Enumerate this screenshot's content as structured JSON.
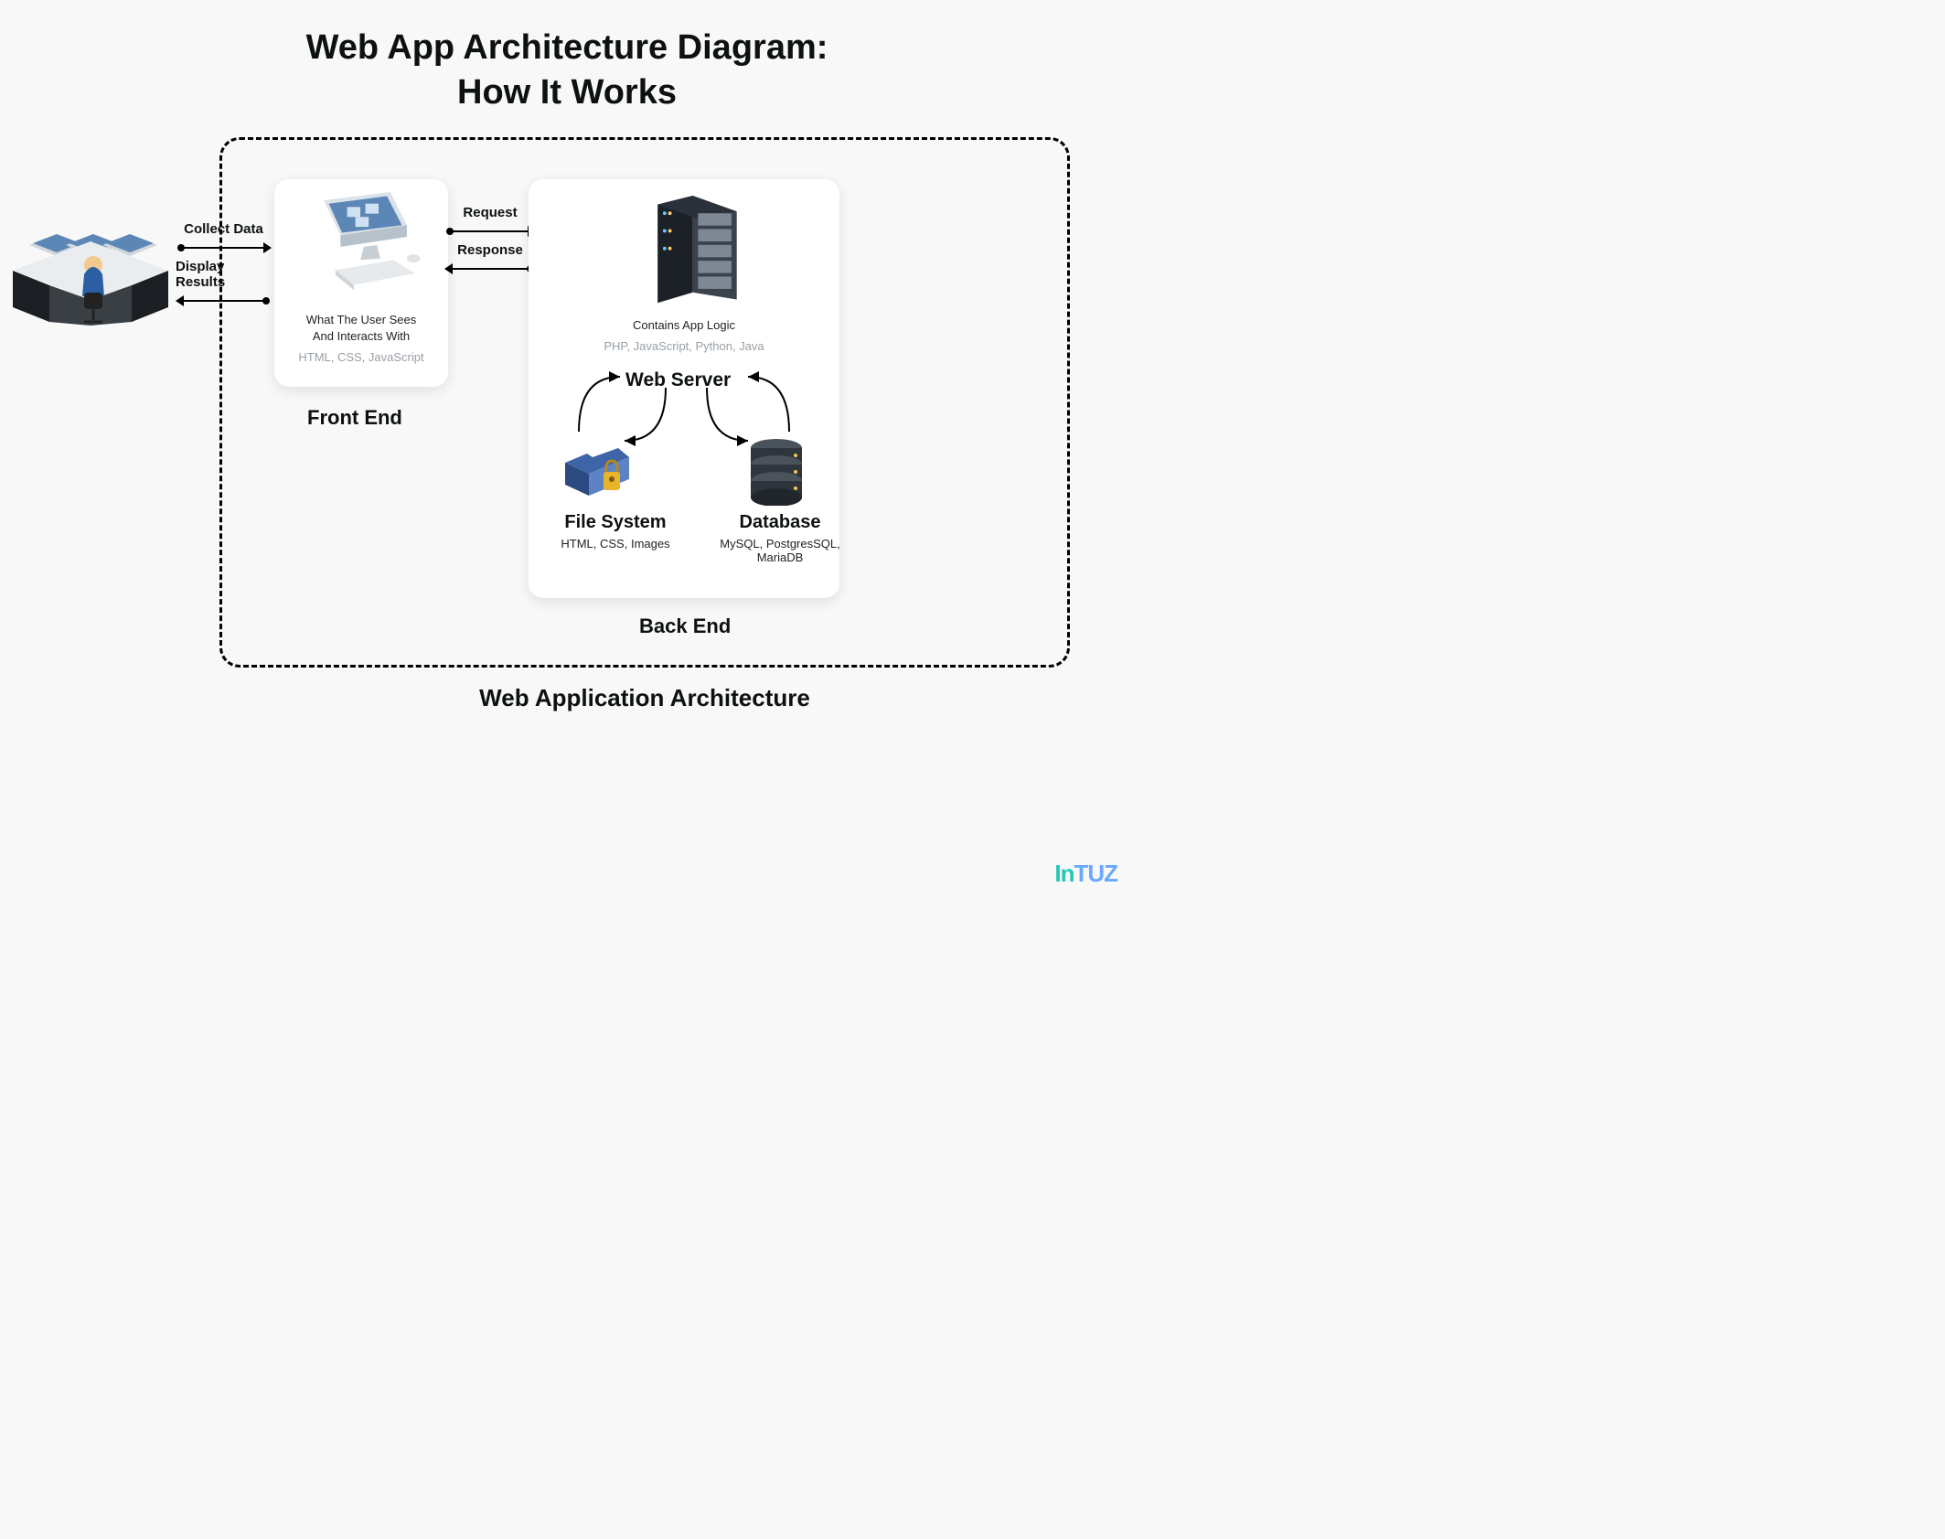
{
  "title_line1": "Web App Architecture Diagram:",
  "title_line2": "How It Works",
  "container_label": "Web Application Architecture",
  "actor_to_frontend": {
    "top_label": "Collect Data",
    "bottom_label": "Display Results"
  },
  "frontend_to_backend": {
    "top_label": "Request",
    "bottom_label": "Response"
  },
  "frontend": {
    "title": "Front End",
    "desc_line1": "What The User Sees",
    "desc_line2": "And Interacts With",
    "tech": "HTML, CSS, JavaScript"
  },
  "backend": {
    "title": "Back End",
    "server_desc": "Contains App Logic",
    "server_tech": "PHP, JavaScript, Python, Java",
    "webserver_label": "Web Server",
    "filesystem": {
      "title": "File System",
      "tech": "HTML, CSS, Images"
    },
    "database": {
      "title": "Database",
      "tech": "MySQL, PostgresSQL, MariaDB"
    }
  },
  "brand": "InTUZ"
}
